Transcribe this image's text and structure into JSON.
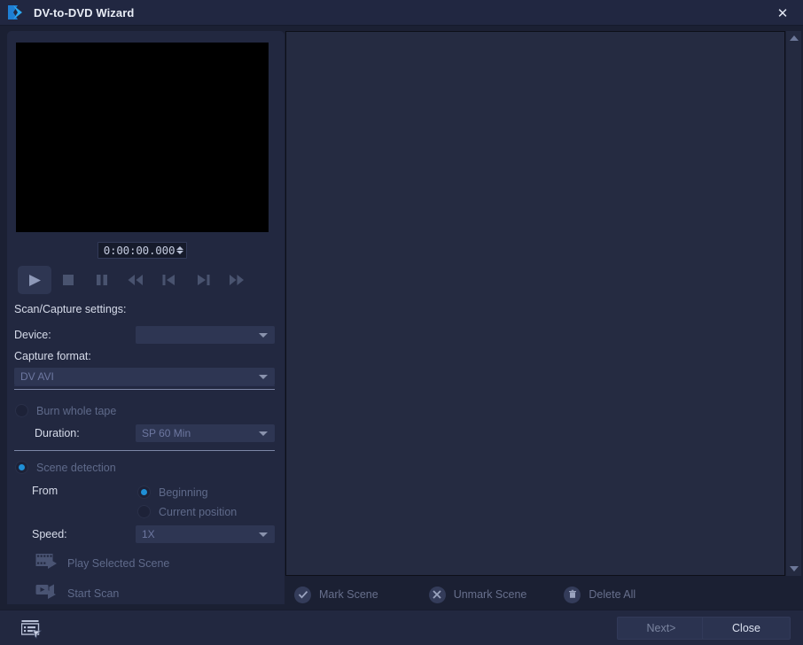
{
  "window": {
    "title": "DV-to-DVD Wizard",
    "app_icon": "play-arrow-logo-icon",
    "close_label": "✕"
  },
  "preview": {
    "timecode": "0:00:00.000",
    "spinner_up_icon": "spinner-up-icon",
    "spinner_down_icon": "spinner-down-icon",
    "transport": [
      {
        "name": "play-button",
        "icon": "play-icon",
        "active": true
      },
      {
        "name": "stop-button",
        "icon": "stop-icon",
        "active": false
      },
      {
        "name": "pause-button",
        "icon": "pause-icon",
        "active": false
      },
      {
        "name": "rewind-button",
        "icon": "rewind-icon",
        "active": false
      },
      {
        "name": "previous-button",
        "icon": "skip-previous-icon",
        "active": false
      },
      {
        "name": "next-frame-button",
        "icon": "skip-next-icon",
        "active": false
      },
      {
        "name": "fast-forward-button",
        "icon": "fast-forward-icon",
        "active": false
      }
    ]
  },
  "settings": {
    "section_title": "Scan/Capture settings:",
    "device_label": "Device:",
    "device_value": "",
    "capture_format_label": "Capture format:",
    "capture_format_value": "DV AVI",
    "burn_whole_tape_label": "Burn whole tape",
    "burn_whole_tape_selected": false,
    "duration_label": "Duration:",
    "duration_value": "SP 60 Min",
    "scene_detection_label": "Scene detection",
    "scene_detection_selected": true,
    "from_label": "From",
    "from_beginning_label": "Beginning",
    "from_beginning_selected": true,
    "from_current_label": "Current position",
    "from_current_selected": false,
    "speed_label": "Speed:",
    "speed_value": "1X"
  },
  "actions": {
    "play_selected_scene": "Play Selected Scene",
    "play_selected_scene_icon": "film-strip-play-icon",
    "start_scan": "Start Scan",
    "start_scan_icon": "video-camera-play-icon"
  },
  "scene_toolbar": {
    "mark_scene": "Mark Scene",
    "mark_scene_icon": "check-circle-icon",
    "unmark_scene": "Unmark Scene",
    "unmark_scene_icon": "x-circle-icon",
    "delete_all": "Delete All",
    "delete_all_icon": "trash-circle-icon"
  },
  "bottom": {
    "settings_icon": "list-settings-cursor-icon",
    "next_label": "Next>",
    "close_label": "Close"
  },
  "scrollbar": {
    "up_icon": "scroll-up-arrow-icon",
    "down_icon": "scroll-down-arrow-icon"
  },
  "colors": {
    "window_bg": "#1b2033",
    "titlebar_bg": "#212741",
    "panel_bg": "#222840",
    "right_panel_bg": "#252b41",
    "accent_blue": "#1f8fd6",
    "text_primary": "#d6dbe9",
    "text_dim": "#5f6a8a"
  }
}
